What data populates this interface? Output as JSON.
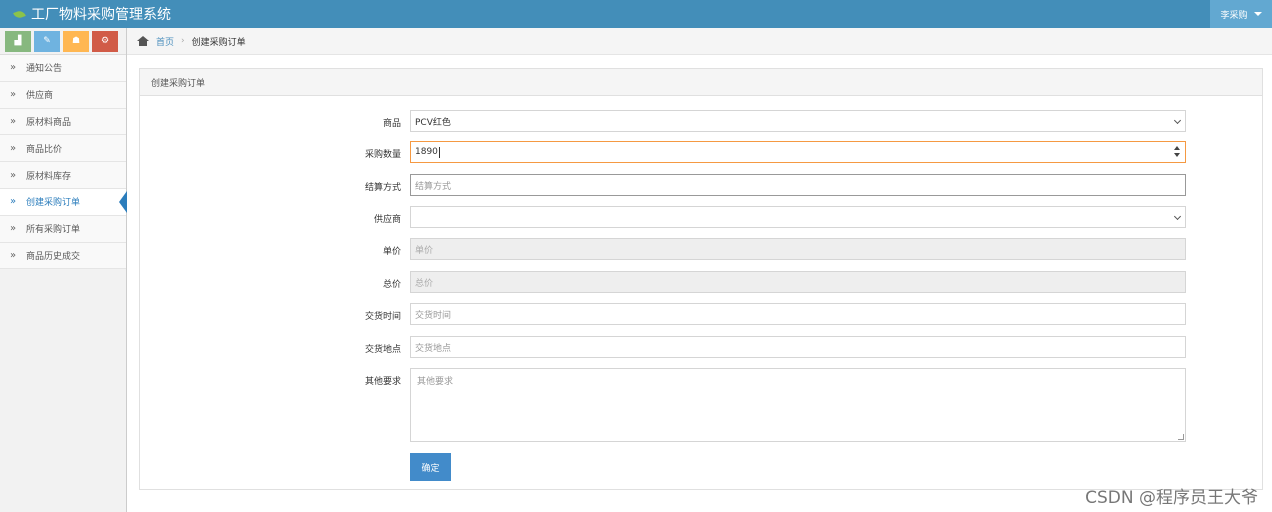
{
  "app": {
    "title": "工厂物料采购管理系统"
  },
  "user": {
    "name": "李采购"
  },
  "shortcuts": [
    {
      "icon": "signal-icon",
      "glyph": "▟"
    },
    {
      "icon": "pencil-icon",
      "glyph": "✎"
    },
    {
      "icon": "users-icon",
      "glyph": "☗"
    },
    {
      "icon": "cogs-icon",
      "glyph": "⚙"
    }
  ],
  "sidebar": {
    "items": [
      {
        "label": "通知公告"
      },
      {
        "label": "供应商"
      },
      {
        "label": "原材料商品"
      },
      {
        "label": "商品比价"
      },
      {
        "label": "原材料库存"
      },
      {
        "label": "创建采购订单",
        "active": true
      },
      {
        "label": "所有采购订单"
      },
      {
        "label": "商品历史成交"
      }
    ]
  },
  "breadcrumb": {
    "home": "首页",
    "current": "创建采购订单"
  },
  "panel": {
    "title": "创建采购订单"
  },
  "form": {
    "product": {
      "label": "商品",
      "value": "PCV红色"
    },
    "quantity": {
      "label": "采购数量",
      "value": "1890"
    },
    "settlement": {
      "label": "结算方式",
      "placeholder": "结算方式"
    },
    "supplier": {
      "label": "供应商",
      "value": ""
    },
    "unit_price": {
      "label": "单价",
      "placeholder": "单价"
    },
    "total_price": {
      "label": "总价",
      "placeholder": "总价"
    },
    "delivery_time": {
      "label": "交货时间",
      "placeholder": "交货时间"
    },
    "delivery_place": {
      "label": "交货地点",
      "placeholder": "交货地点"
    },
    "other": {
      "label": "其他要求",
      "placeholder": "其他要求"
    },
    "submit_label": "确定"
  },
  "watermark": "CSDN @程序员王大爷"
}
